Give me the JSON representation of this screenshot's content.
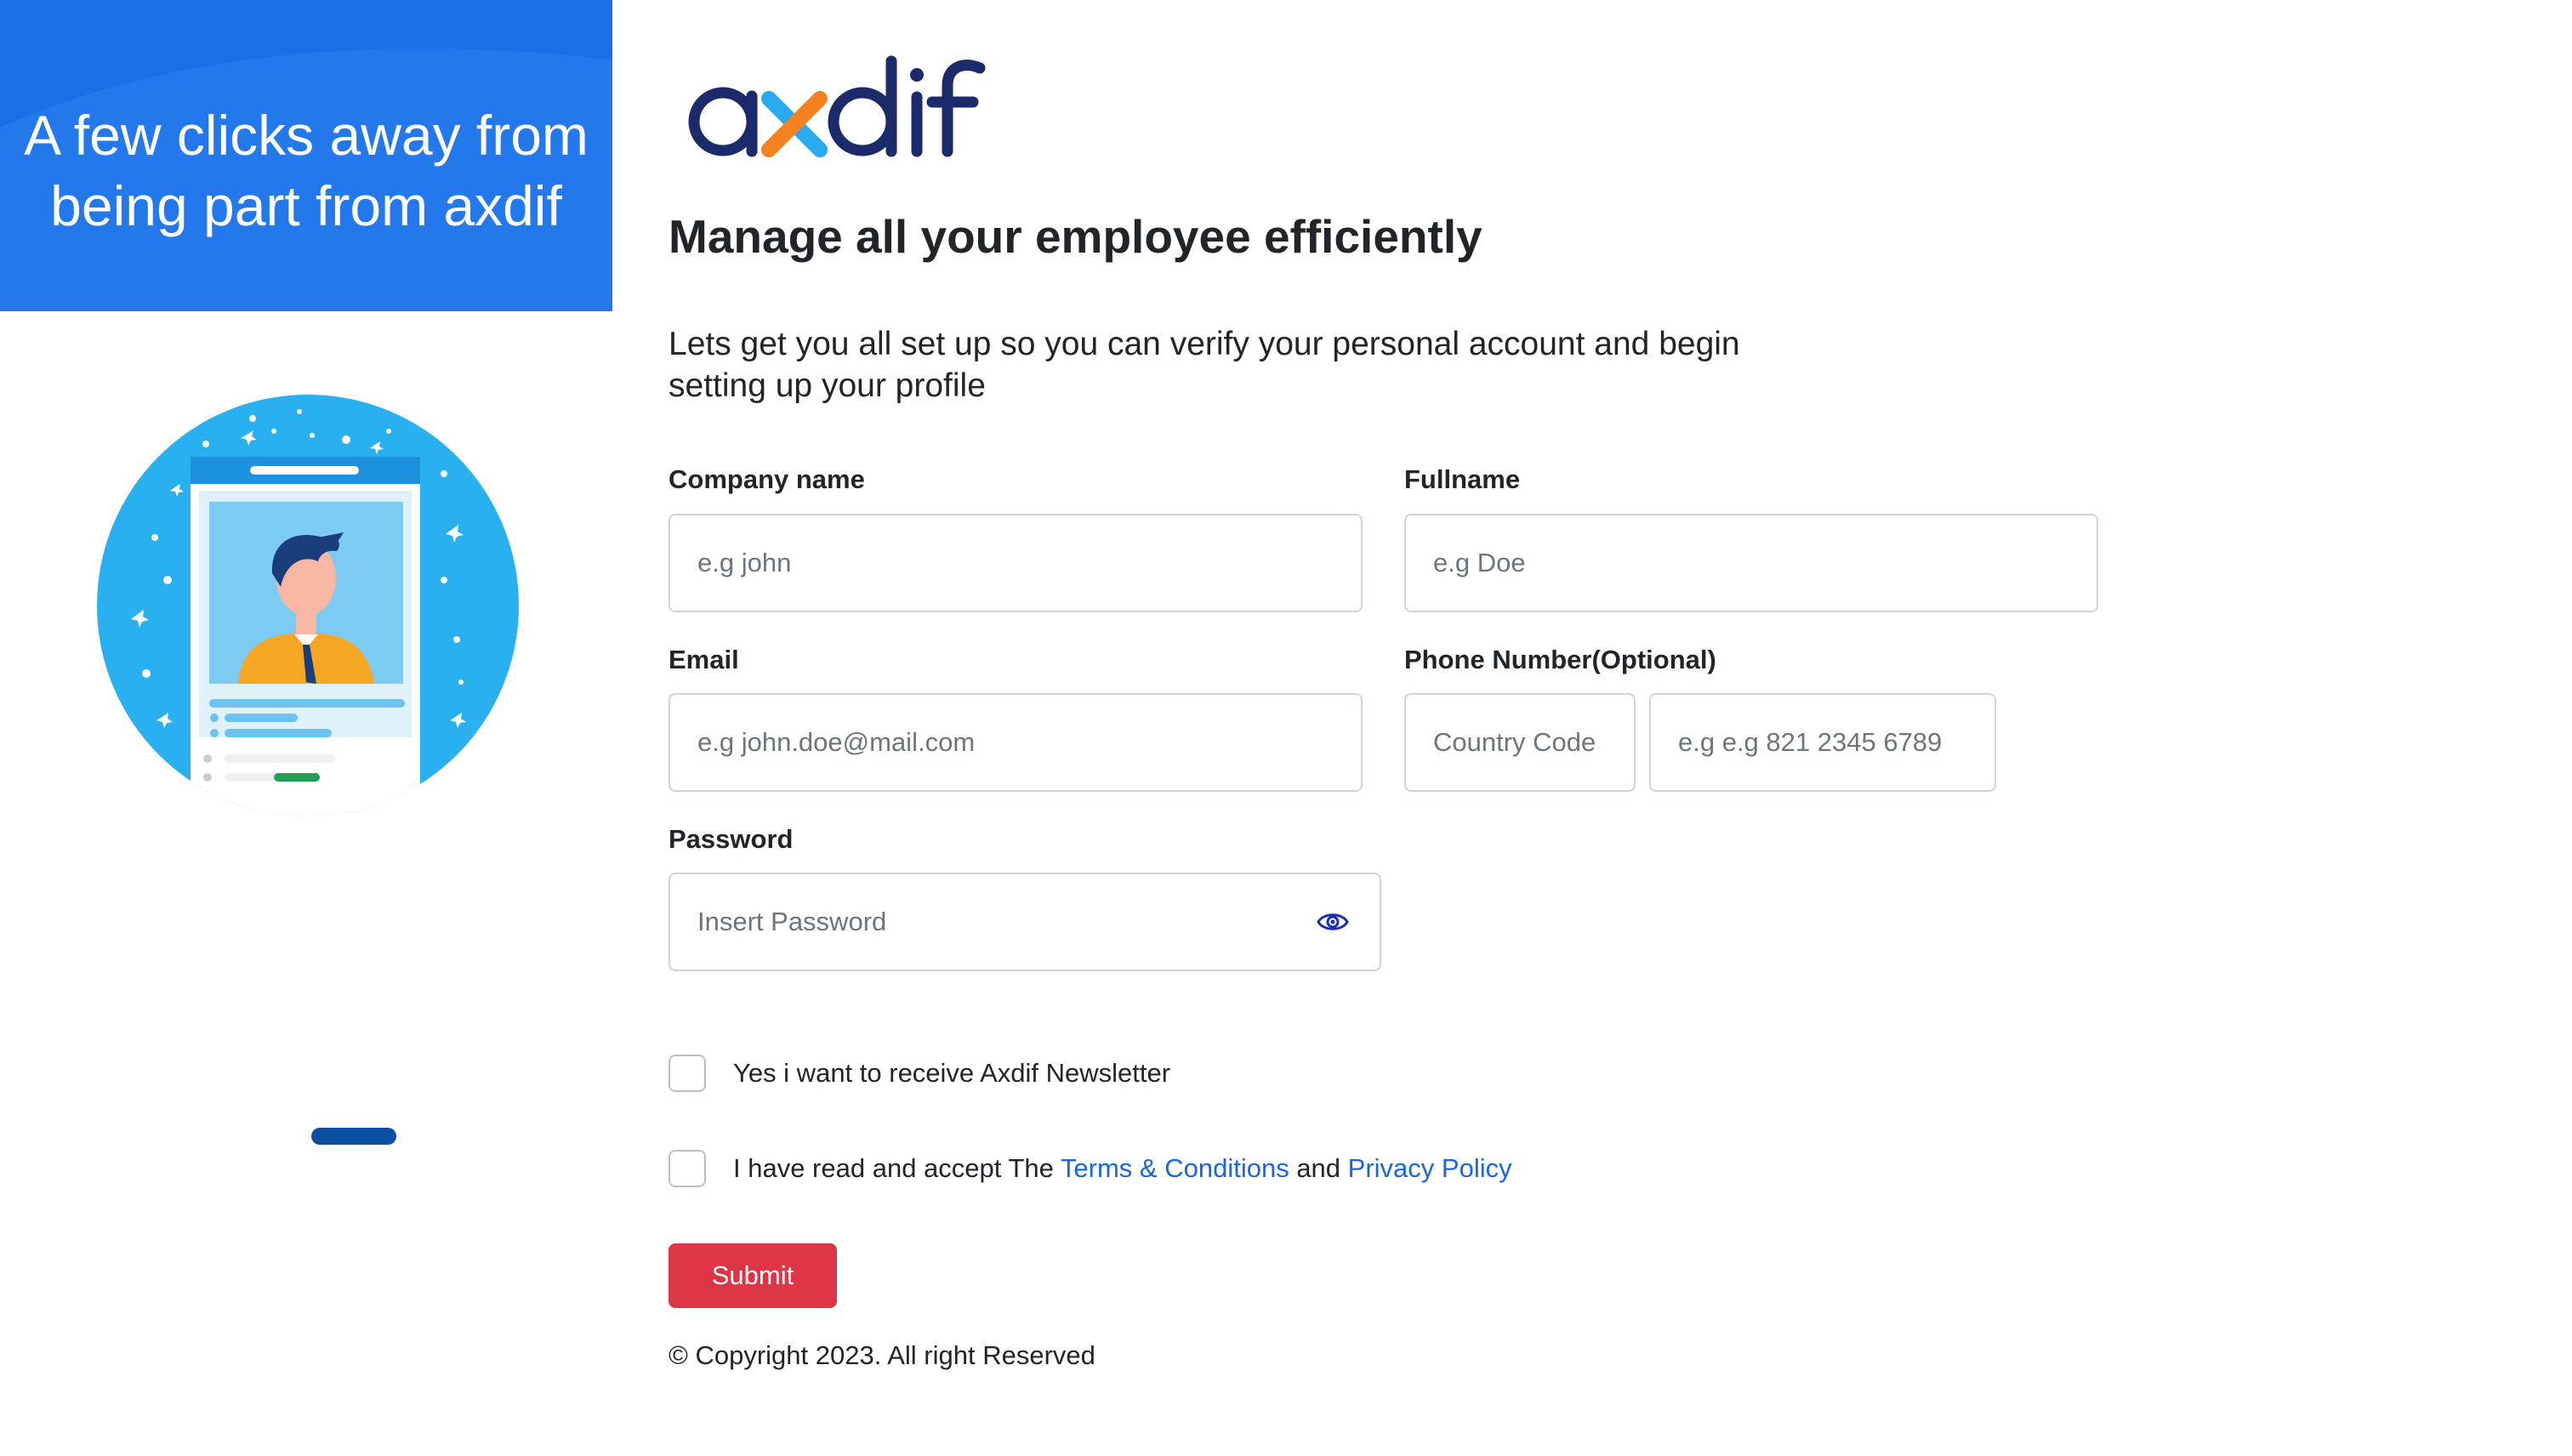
{
  "hero": {
    "text": "A few clicks away from being part from axdif"
  },
  "brand": {
    "logo_text": "axdif",
    "primary_color": "#1b2a6b",
    "accent_orange": "#f5821f",
    "accent_blue": "#29a9f0"
  },
  "main": {
    "headline": "Manage all your employee efficiently",
    "subtitle": "Lets get you all set up so you can verify your personal account and begin setting up your profile"
  },
  "form": {
    "company": {
      "label": "Company name",
      "placeholder": "e.g john"
    },
    "fullname": {
      "label": "Fullname",
      "placeholder": "e.g Doe"
    },
    "email": {
      "label": "Email",
      "placeholder": "e.g john.doe@mail.com"
    },
    "phone": {
      "label": "Phone Number(Optional)",
      "country_placeholder": "Country Code",
      "number_placeholder": "e.g e.g 821 2345 6789"
    },
    "password": {
      "label": "Password",
      "placeholder": "Insert Password",
      "toggle_icon": "eye-icon"
    },
    "newsletter_label": "Yes i want to receive Axdif Newsletter",
    "terms": {
      "prefix": "I have read and accept The ",
      "terms_link": "Terms & Conditions",
      "and": " and ",
      "privacy_link": "Privacy Policy"
    },
    "submit_label": "Submit"
  },
  "footer": {
    "copyright": "© Copyright 2023. All right Reserved"
  },
  "colors": {
    "hero_bg": "#1a6fe6",
    "submit_bg": "#dc3545",
    "link": "#1a66e0",
    "illustration_circle": "#29b0f0",
    "carousel_indicator": "#0b4fa1"
  }
}
